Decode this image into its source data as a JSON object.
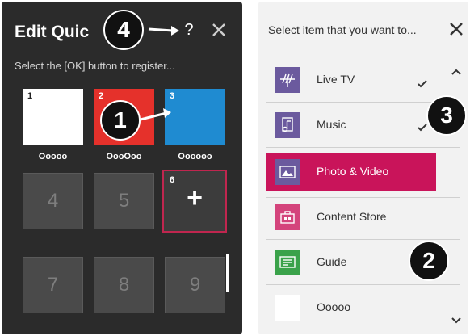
{
  "left_panel": {
    "title": "Edit Quic",
    "help_label": "?",
    "subtitle": "Select the [OK] button to register...",
    "slots": [
      {
        "number": "1",
        "label": "Ooooo",
        "color": "#ffffff"
      },
      {
        "number": "2",
        "label": "OooOoo",
        "color": "#e5312b"
      },
      {
        "number": "3",
        "label": "Oooooo",
        "color": "#1f8bd1"
      }
    ],
    "empty_slots": [
      "4",
      "5",
      "7",
      "8",
      "9"
    ],
    "add_slot": {
      "number": "6",
      "label": "+"
    }
  },
  "right_panel": {
    "title": "Select item that you want to...",
    "items": [
      {
        "label": "Live TV",
        "icon": "antenna-icon",
        "icon_color": "#6b5a9e",
        "checked": true
      },
      {
        "label": "Music",
        "icon": "music-note-icon",
        "icon_color": "#6b5a9e",
        "checked": true
      },
      {
        "label": "Photo & Video",
        "icon": "photo-icon",
        "icon_color": "#6b5a9e",
        "selected": true
      },
      {
        "label": "Content Store",
        "icon": "store-icon",
        "icon_color": "#d4447c"
      },
      {
        "label": "Guide",
        "icon": "guide-icon",
        "icon_color": "#3aa24a"
      },
      {
        "label": "Ooooo",
        "icon": "blank-icon",
        "icon_color": "#ffffff"
      }
    ]
  },
  "callouts": [
    "1",
    "2",
    "3",
    "4"
  ],
  "colors": {
    "accent": "#c9145a",
    "dark_panel": "#2b2b2b",
    "focus_border": "#c0264f"
  }
}
